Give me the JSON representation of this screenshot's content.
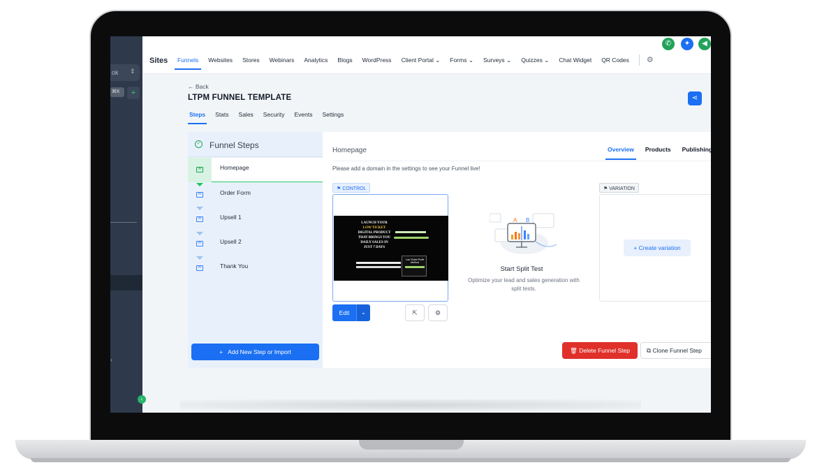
{
  "sidebar": {
    "selector_text": "ok",
    "shortcut": "⌘K",
    "plus": "+",
    "collapse": "‹"
  },
  "topnav": {
    "title": "Sites",
    "items": [
      {
        "label": "Funnels",
        "active": true
      },
      {
        "label": "Websites"
      },
      {
        "label": "Stores"
      },
      {
        "label": "Webinars"
      },
      {
        "label": "Analytics"
      },
      {
        "label": "Blogs"
      },
      {
        "label": "WordPress"
      },
      {
        "label": "Client Portal",
        "dropdown": true
      },
      {
        "label": "Forms",
        "dropdown": true
      },
      {
        "label": "Surveys",
        "dropdown": true
      },
      {
        "label": "Quizzes",
        "dropdown": true
      },
      {
        "label": "Chat Widget"
      },
      {
        "label": "QR Codes"
      }
    ],
    "settings_icon": "gear-icon",
    "header_icons": [
      "phone-icon",
      "sparkle-icon",
      "megaphone-icon"
    ],
    "colors": {
      "phone": "#22a35a",
      "sparkle": "#1b6ff2",
      "megaphone": "#22a35a"
    }
  },
  "page": {
    "back": "← Back",
    "title": "LTPM FUNNEL TEMPLATE",
    "tabs": [
      {
        "label": "Steps",
        "active": true
      },
      {
        "label": "Stats"
      },
      {
        "label": "Sales"
      },
      {
        "label": "Security"
      },
      {
        "label": "Events"
      },
      {
        "label": "Settings"
      }
    ]
  },
  "steps": {
    "title": "Funnel Steps",
    "items": [
      "Homepage",
      "Order Form",
      "Upsell 1",
      "Upsell 2",
      "Thank You"
    ],
    "active_index": 0,
    "add_button": "Add New Step or Import"
  },
  "main": {
    "title": "Homepage",
    "tabs": [
      {
        "label": "Overview",
        "active": true
      },
      {
        "label": "Products"
      },
      {
        "label": "Publishing"
      }
    ],
    "domain_note": "Please add a domain in the settings to see your Funnel live!",
    "control_tag": "CONTROL",
    "variation_tag": "VARIATION",
    "preview": {
      "headline_lines": [
        "LAUNCH YOUR",
        "LOW TICKET",
        "DIGITAL PRODUCT",
        "THAT BRINGS YOU",
        "DAILY SALES IN",
        "JUST 7 DAYS"
      ],
      "card_title": "Low Ticket Profit Method"
    },
    "edit_button": "Edit",
    "split_test": {
      "title": "Start Split Test",
      "description": "Optimize your lead and sales generation with split tests.",
      "labels": [
        "A",
        "B"
      ]
    },
    "create_variation": "Create variation",
    "delete_button": "Delete Funnel Step",
    "clone_button": "Clone Funnel Step"
  },
  "colors": {
    "accent": "#1b6ff2",
    "success": "#22c55e",
    "danger": "#e0302a",
    "sidebar_bg": "#2e3a4b"
  }
}
